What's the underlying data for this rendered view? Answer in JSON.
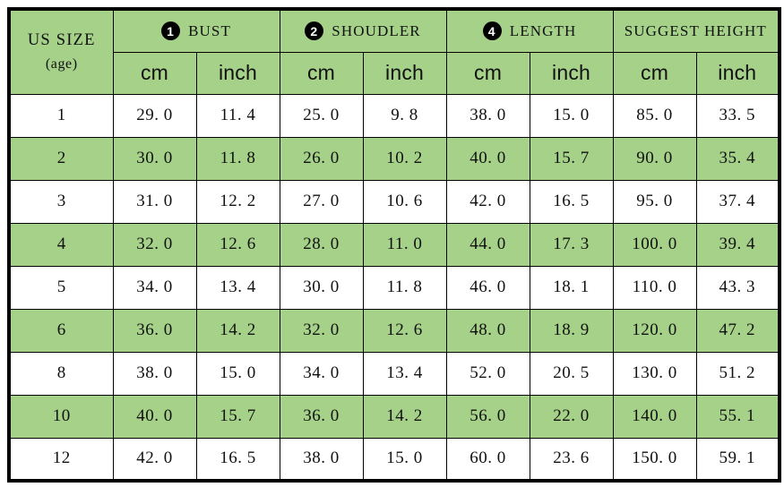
{
  "table": {
    "size_column": {
      "title": "US SIZE",
      "subtitle": "(age)"
    },
    "groups": [
      {
        "badge": "1",
        "label": "BUST"
      },
      {
        "badge": "2",
        "label": "SHOUDLER"
      },
      {
        "badge": "4",
        "label": "LENGTH"
      },
      {
        "badge": "",
        "label": "SUGGEST HEIGHT"
      }
    ],
    "units": [
      "cm",
      "inch",
      "cm",
      "inch",
      "cm",
      "inch",
      "cm",
      "inch"
    ],
    "rows": [
      {
        "size": "1",
        "cells": [
          "29. 0",
          "11. 4",
          "25. 0",
          "9. 8",
          "38. 0",
          "15. 0",
          "85. 0",
          "33. 5"
        ],
        "shaded": false
      },
      {
        "size": "2",
        "cells": [
          "30. 0",
          "11. 8",
          "26. 0",
          "10. 2",
          "40. 0",
          "15. 7",
          "90. 0",
          "35. 4"
        ],
        "shaded": true
      },
      {
        "size": "3",
        "cells": [
          "31. 0",
          "12. 2",
          "27. 0",
          "10. 6",
          "42. 0",
          "16. 5",
          "95. 0",
          "37. 4"
        ],
        "shaded": false
      },
      {
        "size": "4",
        "cells": [
          "32. 0",
          "12. 6",
          "28. 0",
          "11. 0",
          "44. 0",
          "17. 3",
          "100. 0",
          "39. 4"
        ],
        "shaded": true
      },
      {
        "size": "5",
        "cells": [
          "34. 0",
          "13. 4",
          "30. 0",
          "11. 8",
          "46. 0",
          "18. 1",
          "110. 0",
          "43. 3"
        ],
        "shaded": false
      },
      {
        "size": "6",
        "cells": [
          "36. 0",
          "14. 2",
          "32. 0",
          "12. 6",
          "48. 0",
          "18. 9",
          "120. 0",
          "47. 2"
        ],
        "shaded": true
      },
      {
        "size": "8",
        "cells": [
          "38. 0",
          "15. 0",
          "34. 0",
          "13. 4",
          "52. 0",
          "20. 5",
          "130. 0",
          "51. 2"
        ],
        "shaded": false
      },
      {
        "size": "10",
        "cells": [
          "40. 0",
          "15. 7",
          "36. 0",
          "14. 2",
          "56. 0",
          "22. 0",
          "140. 0",
          "55. 1"
        ],
        "shaded": true
      },
      {
        "size": "12",
        "cells": [
          "42. 0",
          "16. 5",
          "38. 0",
          "15. 0",
          "60. 0",
          "23. 6",
          "150. 0",
          "59. 1"
        ],
        "shaded": false
      }
    ]
  },
  "colors": {
    "accent_green": "#a5d189",
    "row_white": "#ffffff",
    "border": "#000000",
    "badge_fill": "#000000",
    "badge_text": "#ffffff"
  }
}
